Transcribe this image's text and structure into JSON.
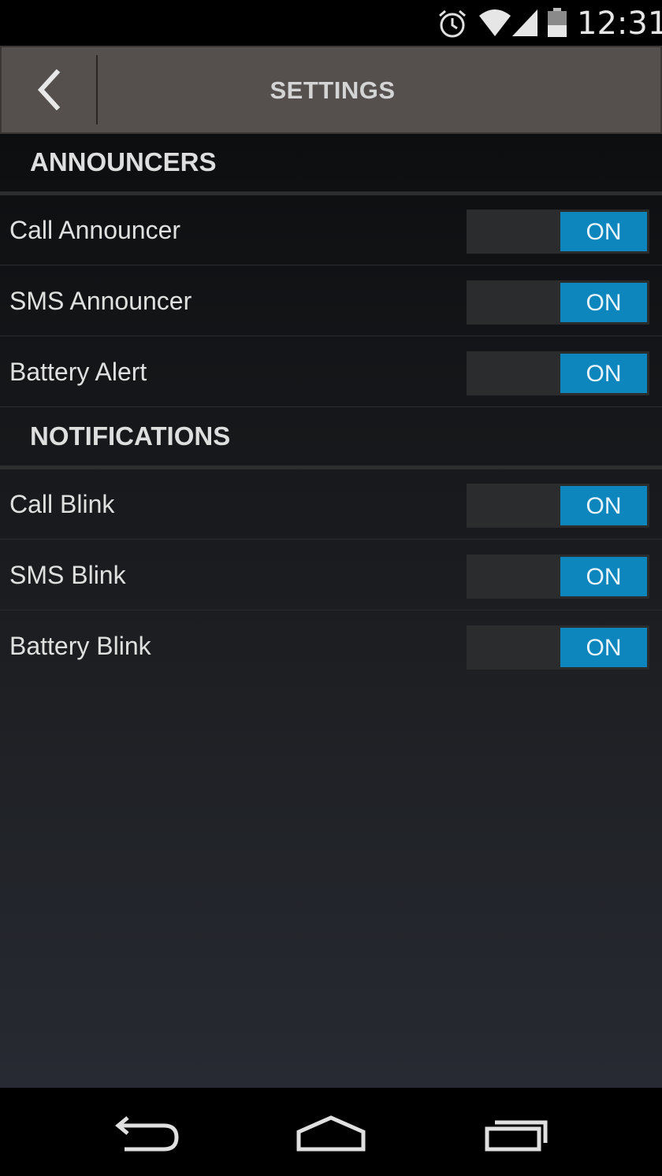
{
  "status_bar": {
    "time": "12:31",
    "icons": [
      "alarm-icon",
      "wifi-icon",
      "signal-icon",
      "battery-icon"
    ]
  },
  "action_bar": {
    "title": "SETTINGS",
    "back_icon": "chevron-left-icon"
  },
  "sections": [
    {
      "title": "ANNOUNCERS",
      "items": [
        {
          "label": "Call Announcer",
          "toggle": "ON"
        },
        {
          "label": "SMS Announcer",
          "toggle": "ON"
        },
        {
          "label": "Battery Alert",
          "toggle": "ON"
        }
      ]
    },
    {
      "title": "NOTIFICATIONS",
      "items": [
        {
          "label": "Call Blink",
          "toggle": "ON"
        },
        {
          "label": "SMS Blink",
          "toggle": "ON"
        },
        {
          "label": "Battery Blink",
          "toggle": "ON"
        }
      ]
    }
  ],
  "nav_bar": {
    "icons": [
      "back-icon",
      "home-icon",
      "recents-icon"
    ]
  },
  "colors": {
    "accent": "#0c86bd",
    "action_bar": "#55504d"
  }
}
